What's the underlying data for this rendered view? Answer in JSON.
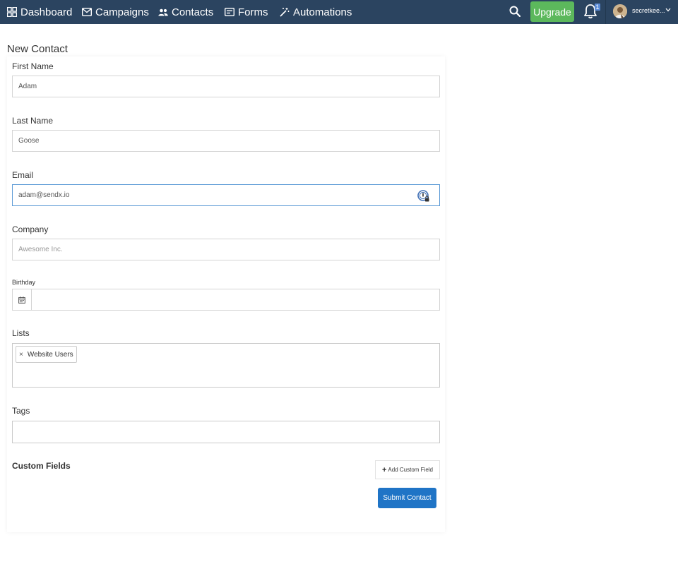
{
  "nav": {
    "items": [
      {
        "label": "Dashboard",
        "icon": "dashboard-icon"
      },
      {
        "label": "Campaigns",
        "icon": "envelope-icon"
      },
      {
        "label": "Contacts",
        "icon": "people-icon"
      },
      {
        "label": "Forms",
        "icon": "form-icon"
      },
      {
        "label": "Automations",
        "icon": "magic-wand-icon"
      }
    ],
    "upgrade_label": "Upgrade",
    "notification_count": "1",
    "user_name": "secretkee..."
  },
  "form": {
    "title": "New Contact",
    "first_name": {
      "label": "First Name",
      "value": "Adam"
    },
    "last_name": {
      "label": "Last Name",
      "value": "Goose"
    },
    "email": {
      "label": "Email",
      "value": "adam@sendx.io"
    },
    "company": {
      "label": "Company",
      "placeholder": "Awesome Inc."
    },
    "birthday": {
      "label": "Birthday",
      "value": ""
    },
    "lists": {
      "label": "Lists",
      "selected": [
        "Website Users"
      ]
    },
    "tags": {
      "label": "Tags",
      "value": ""
    },
    "custom_fields": {
      "label": "Custom Fields",
      "add_label": "Add Custom Field"
    },
    "submit_label": "Submit Contact"
  },
  "colors": {
    "nav_bg": "#2b4460",
    "upgrade_bg": "#5cb85c",
    "submit_bg": "#1f74c6",
    "focus_border": "#5b9ad6"
  }
}
